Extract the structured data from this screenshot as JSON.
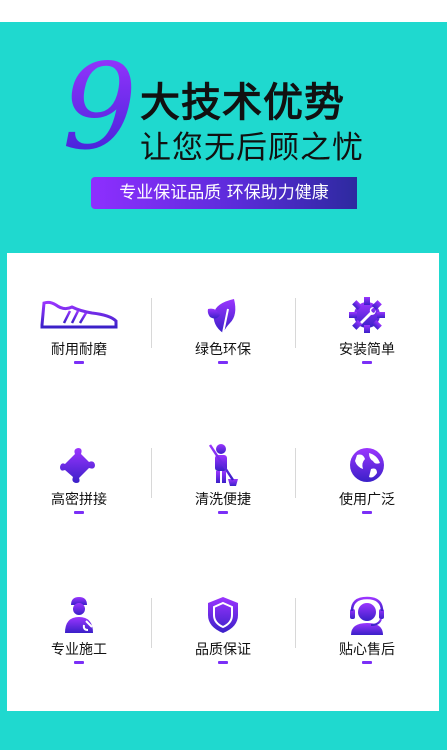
{
  "header": {
    "nine": "9",
    "title_main": "大技术优势",
    "title_sub": "让您无后顾之忧",
    "ribbon": "专业保证品质  环保助力健康"
  },
  "colors": {
    "background": "#1fd9cf",
    "accent_purple": "#7b2ff7",
    "accent_dark": "#3d23d6"
  },
  "features": [
    {
      "label": "耐用耐磨",
      "icon": "sneaker-icon"
    },
    {
      "label": "绿色环保",
      "icon": "leaf-icon"
    },
    {
      "label": "安装简单",
      "icon": "gear-wrench-icon"
    },
    {
      "label": "高密拼接",
      "icon": "puzzle-icon"
    },
    {
      "label": "清洗便捷",
      "icon": "cleaner-icon"
    },
    {
      "label": "使用广泛",
      "icon": "globe-icon"
    },
    {
      "label": "专业施工",
      "icon": "worker-icon"
    },
    {
      "label": "品质保证",
      "icon": "shield-icon"
    },
    {
      "label": "贴心售后",
      "icon": "headset-icon"
    }
  ]
}
